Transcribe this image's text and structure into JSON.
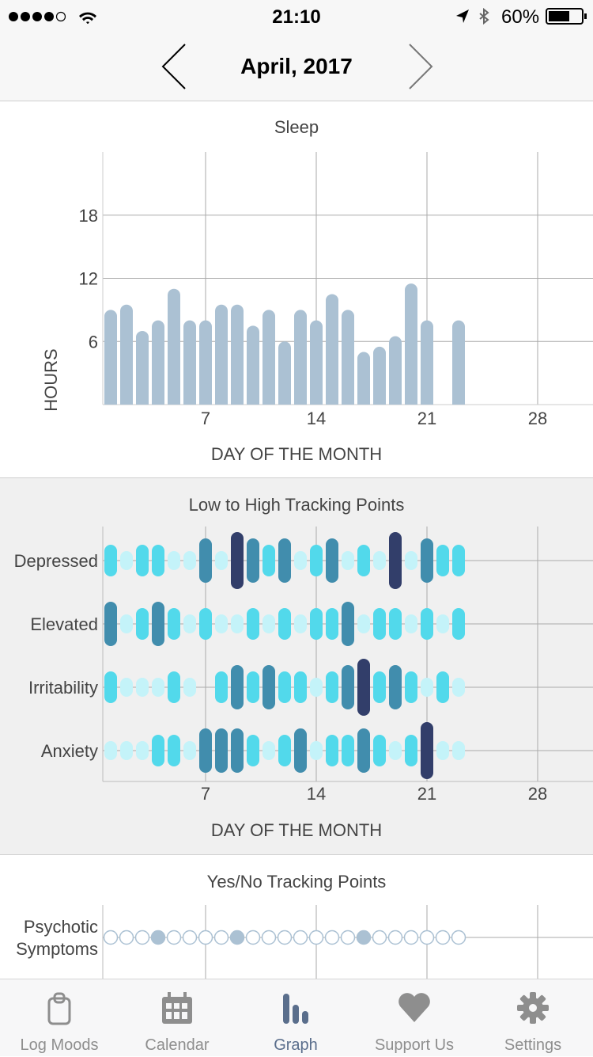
{
  "status_bar": {
    "time": "21:10",
    "battery": "60%",
    "signal_bars": 4,
    "icons": [
      "signal-dots-icon",
      "wifi-icon",
      "location-arrow-icon",
      "bluetooth-icon",
      "battery-icon"
    ]
  },
  "nav": {
    "title": "April, 2017",
    "prev_icon": "chevron-left-icon",
    "next_icon": "chevron-right-icon"
  },
  "sleep": {
    "title": "Sleep"
  },
  "tracking": {
    "title": "Low to High Tracking Points"
  },
  "yesno": {
    "title": "Yes/No Tracking Points"
  },
  "chart_data": [
    {
      "type": "bar",
      "title": "Sleep",
      "xlabel": "DAY OF THE MONTH",
      "ylabel": "HOURS",
      "ylim": [
        0,
        24
      ],
      "xlim": [
        0,
        31
      ],
      "yticks": [
        6,
        12,
        18
      ],
      "xticks": [
        7,
        14,
        21,
        28
      ],
      "grid": true,
      "color": "#abc1d3",
      "x": [
        1,
        2,
        3,
        4,
        5,
        6,
        7,
        8,
        9,
        10,
        11,
        12,
        13,
        14,
        15,
        16,
        17,
        18,
        19,
        20,
        21,
        22,
        23
      ],
      "values": [
        9,
        9.5,
        7,
        8,
        11,
        8,
        8,
        9.5,
        9.5,
        7.5,
        9,
        6,
        9,
        8,
        10.5,
        9,
        5,
        5.5,
        6.5,
        11.5,
        8,
        null,
        8
      ]
    },
    {
      "type": "scatter",
      "title": "Low to High Tracking Points",
      "xlabel": "DAY OF THE MONTH",
      "xticks": [
        7,
        14,
        21,
        28
      ],
      "grid": true,
      "level_colors": {
        "1": "#c4f3f9",
        "2": "#52d9eb",
        "3": "#418dad",
        "4": "#323e6a"
      },
      "x": [
        1,
        2,
        3,
        4,
        5,
        6,
        7,
        8,
        9,
        10,
        11,
        12,
        13,
        14,
        15,
        16,
        17,
        18,
        19,
        20,
        21,
        22,
        23
      ],
      "series": [
        {
          "name": "Depressed",
          "values": [
            2,
            1,
            2,
            2,
            1,
            1,
            3,
            1,
            4,
            3,
            2,
            3,
            1,
            2,
            3,
            1,
            2,
            1,
            4,
            1,
            3,
            2,
            2
          ]
        },
        {
          "name": "Elevated",
          "values": [
            3,
            1,
            2,
            3,
            2,
            1,
            2,
            1,
            1,
            2,
            1,
            2,
            1,
            2,
            2,
            3,
            1,
            2,
            2,
            1,
            2,
            1,
            2
          ]
        },
        {
          "name": "Irritability",
          "values": [
            2,
            1,
            1,
            1,
            2,
            1,
            null,
            2,
            3,
            2,
            3,
            2,
            2,
            1,
            2,
            3,
            4,
            2,
            3,
            2,
            1,
            2,
            1
          ]
        },
        {
          "name": "Anxiety",
          "values": [
            1,
            1,
            1,
            2,
            2,
            1,
            3,
            3,
            3,
            2,
            1,
            2,
            3,
            1,
            2,
            2,
            3,
            2,
            1,
            2,
            4,
            1,
            1
          ]
        }
      ]
    },
    {
      "type": "scatter",
      "title": "Yes/No Tracking Points",
      "grid": true,
      "color": "#abc1d3",
      "x": [
        1,
        2,
        3,
        4,
        5,
        6,
        7,
        8,
        9,
        10,
        11,
        12,
        13,
        14,
        15,
        16,
        17,
        18,
        19,
        20,
        21,
        22,
        23
      ],
      "series": [
        {
          "name": "Psychotic Symptoms",
          "name_lines": [
            "Psychotic",
            "Symptoms"
          ],
          "values": [
            false,
            false,
            false,
            true,
            false,
            false,
            false,
            false,
            true,
            false,
            false,
            false,
            false,
            false,
            false,
            false,
            true,
            false,
            false,
            false,
            false,
            false,
            false
          ]
        }
      ]
    }
  ],
  "tabbar": {
    "items": [
      {
        "label": "Log Moods",
        "icon": "clipboard-icon",
        "active": false
      },
      {
        "label": "Calendar",
        "icon": "calendar-icon",
        "active": false
      },
      {
        "label": "Graph",
        "icon": "bar-graph-icon",
        "active": true
      },
      {
        "label": "Support Us",
        "icon": "heart-icon",
        "active": false
      },
      {
        "label": "Settings",
        "icon": "gear-icon",
        "active": false
      }
    ]
  }
}
